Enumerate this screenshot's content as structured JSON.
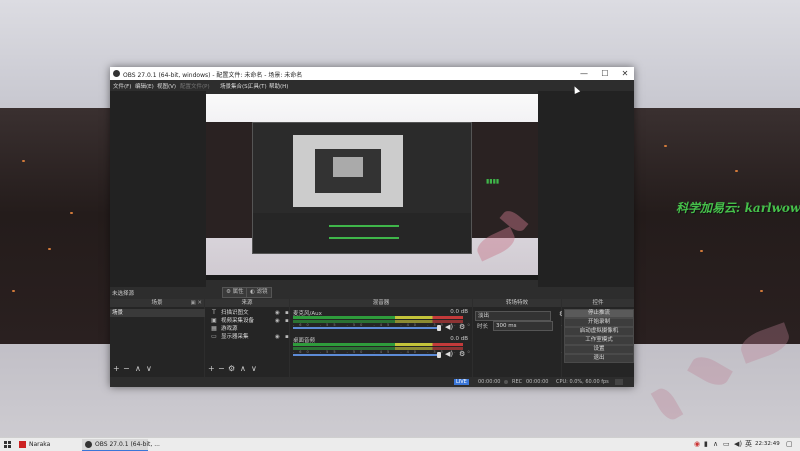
{
  "background": {
    "caption": "科学加易云: karlwow"
  },
  "window": {
    "title": "OBS 27.0.1 (64-bit, windows) - 配置文件: 未命名 - 场景: 未命名",
    "controls": {
      "minimize": "—",
      "maximize": "☐",
      "close": "✕"
    }
  },
  "menu": {
    "items": [
      {
        "label": "文件(F)",
        "enabled": true
      },
      {
        "label": "编辑(E)",
        "enabled": true
      },
      {
        "label": "视图(V)",
        "enabled": true
      },
      {
        "label": "配置文件(P)",
        "enabled": false
      },
      {
        "label": "场景集合(S)",
        "enabled": true
      },
      {
        "label": "工具(T)",
        "enabled": true
      },
      {
        "label": "帮助(H)",
        "enabled": true
      }
    ]
  },
  "preview_toolbar": {
    "no_source": "未选择源",
    "properties": "⚙ 属性",
    "filters": "◐ 滤镜"
  },
  "scenes": {
    "header": "场景",
    "items": [
      "场景"
    ],
    "controls": [
      "+",
      "−",
      "∧",
      "∨"
    ]
  },
  "sources": {
    "header": "来源",
    "items": [
      {
        "icon": "T",
        "label": "扫描识图文"
      },
      {
        "icon": "▣",
        "label": "视频采集设备"
      },
      {
        "icon": "▦",
        "label": "游戏源"
      },
      {
        "icon": "▭",
        "label": "显示器采集"
      }
    ],
    "controls": [
      "+",
      "−",
      "⚙",
      "∧",
      "∨"
    ]
  },
  "mixer": {
    "header": "混音器",
    "channels": [
      {
        "name": "麦克风/Aux",
        "db": "0.0 dB"
      },
      {
        "name": "桌面音频",
        "db": "0.0 dB"
      }
    ],
    "ticks": "-60 -55 -50 -45 -40 -35 -30 -25 -20 -15 -10 -5 0"
  },
  "transitions": {
    "header": "转场特效",
    "type": "淡出",
    "duration_label": "时长",
    "duration": "300 ms"
  },
  "controls": {
    "header": "控件",
    "buttons": [
      "停止推流",
      "开始录制",
      "启动虚拟摄像机",
      "工作室模式",
      "设置",
      "退出"
    ]
  },
  "status": {
    "frames": "LIVE",
    "live_time": "00:00:00",
    "rec_label": "REC",
    "rec_time": "00:00:00",
    "cpu": "CPU: 0.0%, 60.00 fps"
  },
  "taskbar": {
    "items": [
      {
        "label": "Naraka",
        "active": false
      },
      {
        "label": "OBS 27.0.1 (64-bit, ...",
        "active": true
      }
    ],
    "clock": "22:32:49"
  },
  "colors": {
    "accent_green": "#3fb64a",
    "fader_blue": "#5d8bd6",
    "obs_dark": "#2d2d2d"
  }
}
